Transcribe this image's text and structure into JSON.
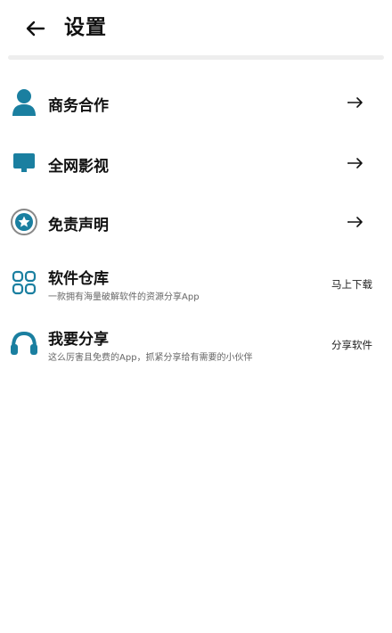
{
  "header": {
    "title": "设置"
  },
  "colors": {
    "accent": "#1a7fa0",
    "divider": "#eeeeee"
  },
  "menu": [
    {
      "label": "商务合作",
      "icon": "person-icon"
    },
    {
      "label": "全网影视",
      "icon": "monitor-icon"
    },
    {
      "label": "免责声明",
      "icon": "star-badge-icon"
    },
    {
      "label": "软件仓库",
      "subtitle": "一款拥有海量破解软件的资源分享App",
      "action": "马上下载",
      "icon": "grid-icon"
    },
    {
      "label": "我要分享",
      "subtitle": "这么厉害且免费的App，抓紧分享给有需要的小伙伴",
      "action": "分享软件",
      "icon": "headphones-icon"
    }
  ]
}
